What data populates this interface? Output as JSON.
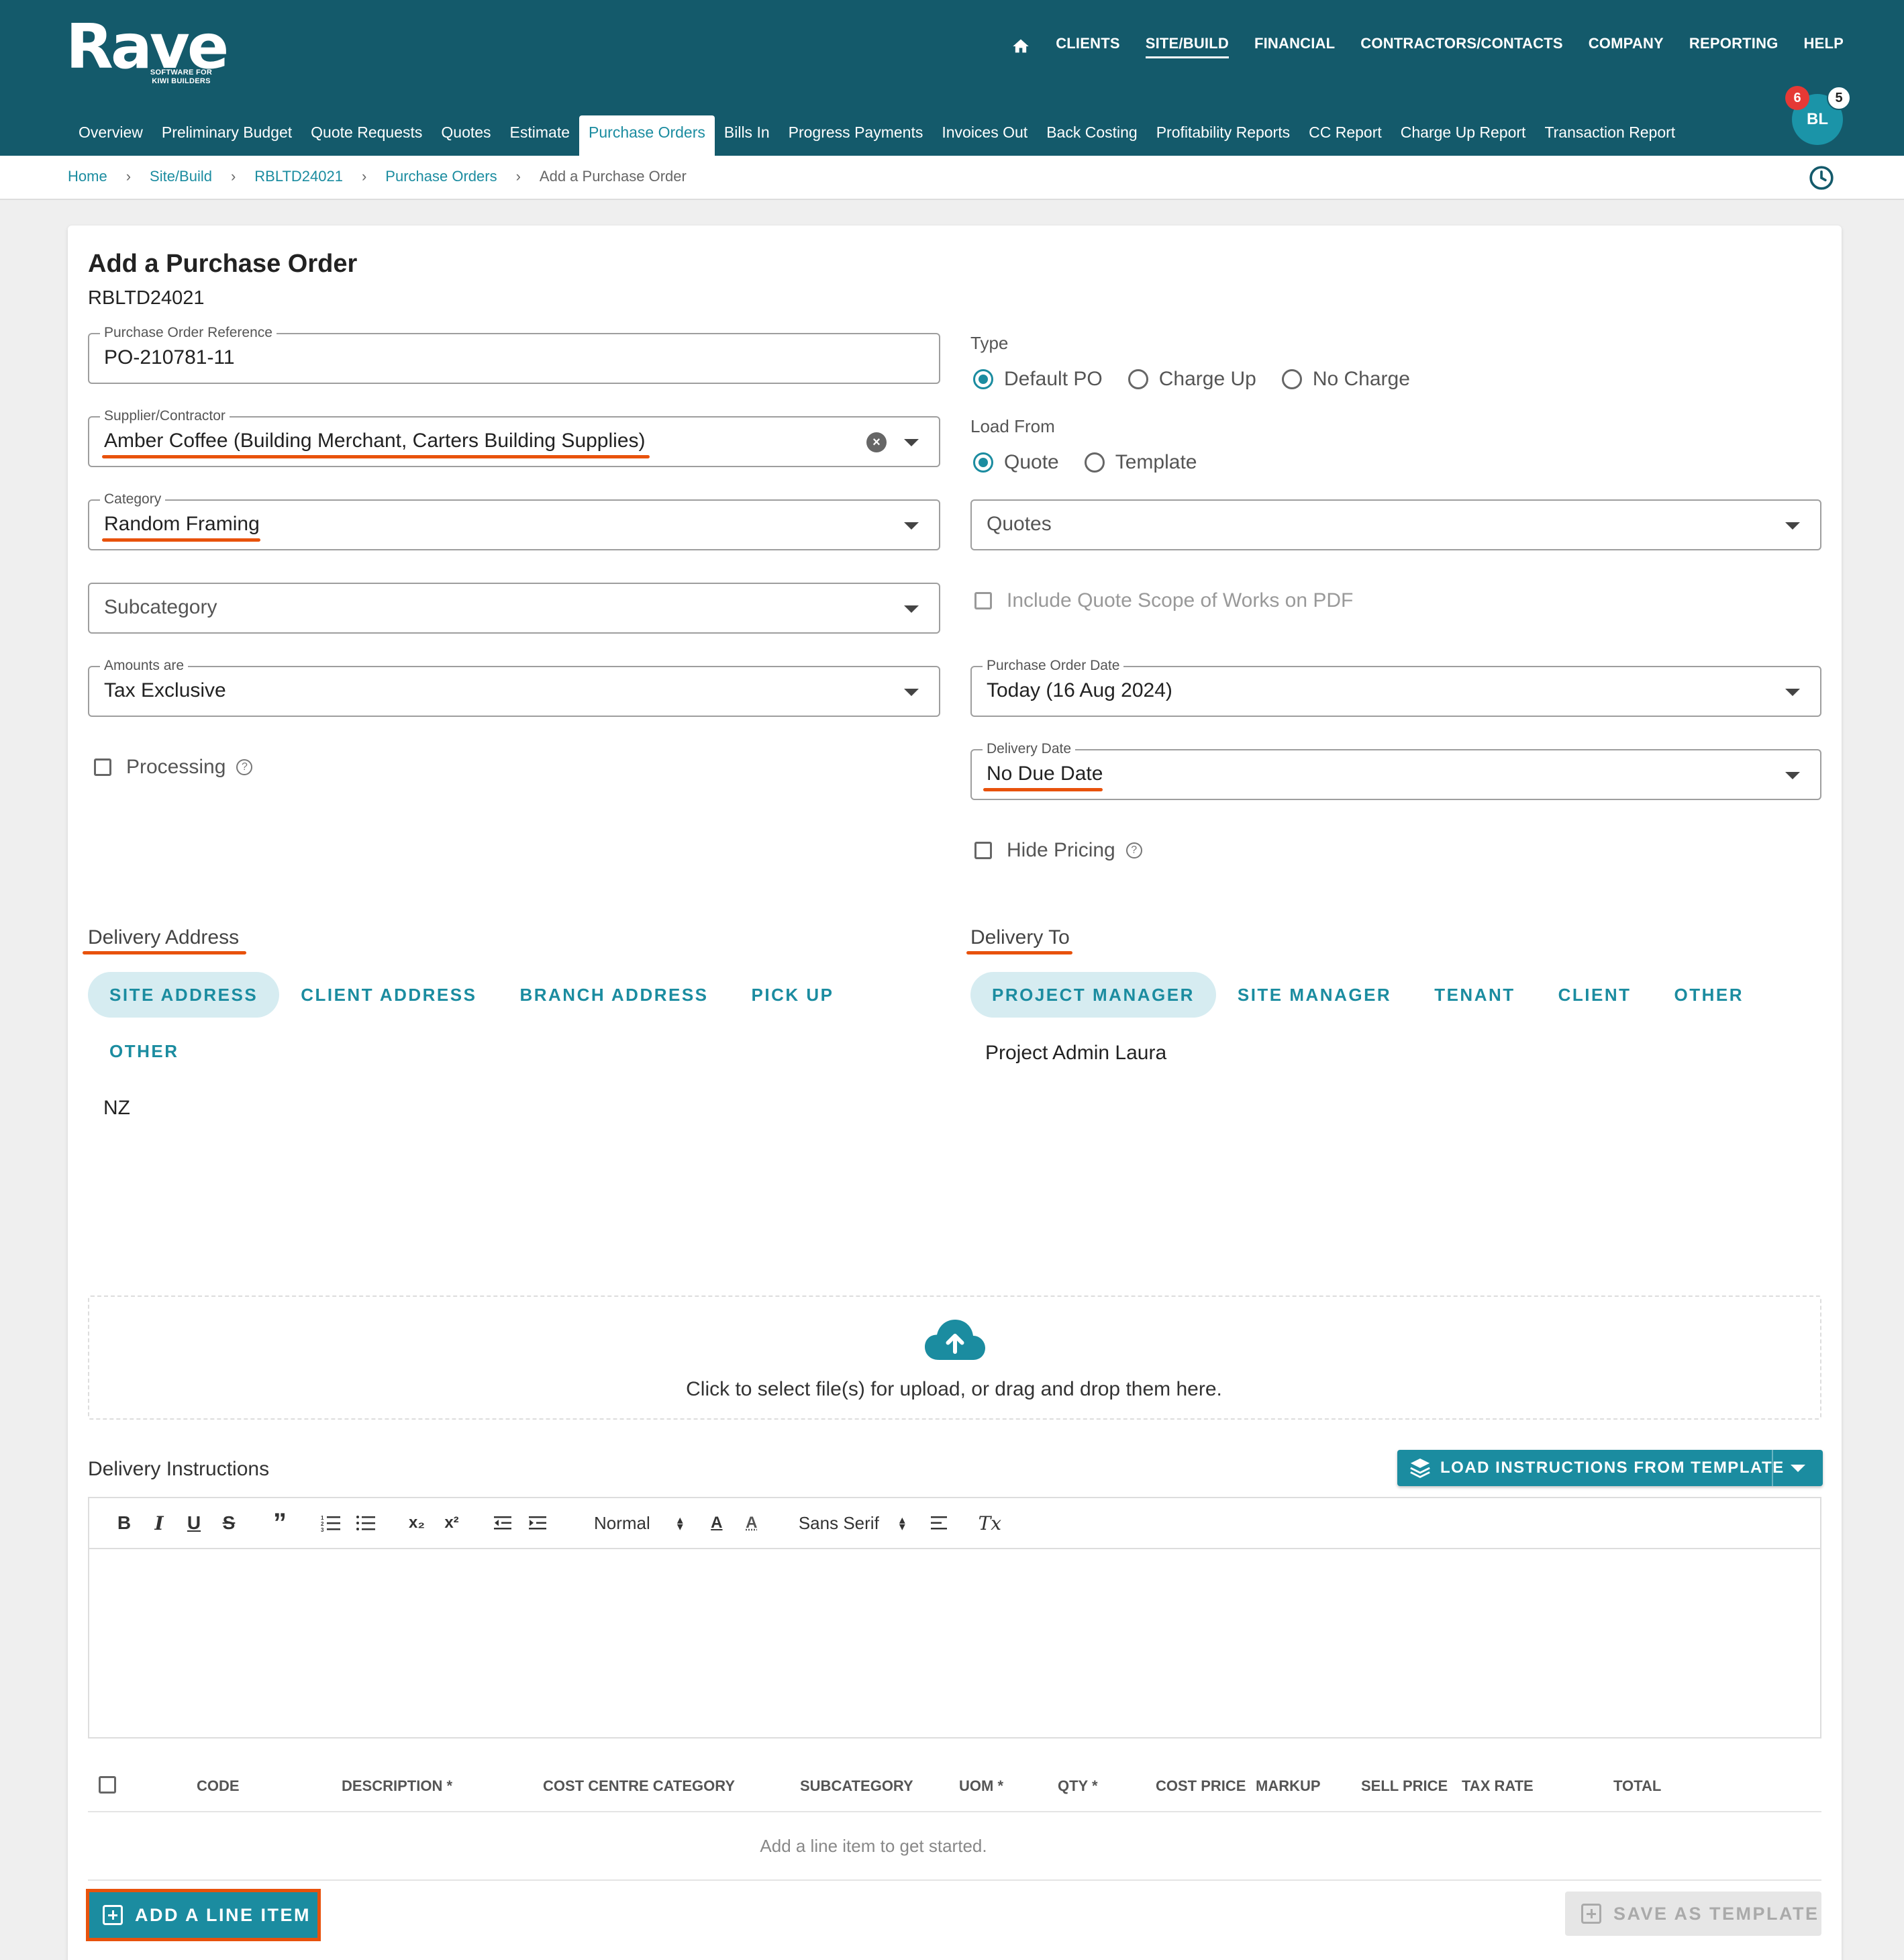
{
  "brand": {
    "name": "Rave",
    "tagline": "SOFTWARE FOR KIWI BUILDERS"
  },
  "top_nav": [
    "CLIENTS",
    "SITE/BUILD",
    "FINANCIAL",
    "CONTRACTORS/CONTACTS",
    "COMPANY",
    "REPORTING",
    "HELP"
  ],
  "top_nav_active": "SITE/BUILD",
  "sub_nav": [
    "Overview",
    "Preliminary Budget",
    "Quote Requests",
    "Quotes",
    "Estimate",
    "Purchase Orders",
    "Bills In",
    "Progress Payments",
    "Invoices Out",
    "Back Costing",
    "Profitability Reports",
    "CC Report",
    "Charge Up Report",
    "Transaction Report"
  ],
  "sub_nav_active": "Purchase Orders",
  "user": {
    "initials": "BL",
    "notifications": "6",
    "messages": "5"
  },
  "breadcrumb": [
    "Home",
    "Site/Build",
    "RBLTD24021",
    "Purchase Orders",
    "Add a Purchase Order"
  ],
  "page": {
    "title": "Add a Purchase Order",
    "job_code": "RBLTD24021"
  },
  "form": {
    "po_reference": {
      "label": "Purchase Order Reference",
      "value": "PO-210781-11"
    },
    "supplier": {
      "label": "Supplier/Contractor",
      "value": "Amber Coffee (Building Merchant, Carters Building Supplies)"
    },
    "category": {
      "label": "Category",
      "value": "Random Framing"
    },
    "subcategory": {
      "placeholder": "Subcategory"
    },
    "amounts": {
      "label": "Amounts are",
      "value": "Tax Exclusive"
    },
    "processing": {
      "label": "Processing",
      "checked": false
    },
    "type": {
      "label": "Type",
      "options": [
        "Default PO",
        "Charge Up",
        "No Charge"
      ],
      "selected": "Default PO"
    },
    "load_from": {
      "label": "Load From",
      "options": [
        "Quote",
        "Template"
      ],
      "selected": "Quote"
    },
    "quotes": {
      "placeholder": "Quotes"
    },
    "include_scope": {
      "label": "Include Quote Scope of Works on PDF",
      "checked": false
    },
    "po_date": {
      "label": "Purchase Order Date",
      "value": "Today (16 Aug 2024)"
    },
    "delivery_date": {
      "label": "Delivery Date",
      "value": "No Due Date"
    },
    "hide_pricing": {
      "label": "Hide Pricing",
      "checked": false
    }
  },
  "delivery_address": {
    "title": "Delivery Address",
    "options": [
      "SITE ADDRESS",
      "CLIENT ADDRESS",
      "BRANCH ADDRESS",
      "PICK UP",
      "OTHER"
    ],
    "selected": "SITE ADDRESS",
    "value": "NZ"
  },
  "delivery_to": {
    "title": "Delivery To",
    "options": [
      "PROJECT MANAGER",
      "SITE MANAGER",
      "TENANT",
      "CLIENT",
      "OTHER"
    ],
    "selected": "PROJECT MANAGER",
    "value": "Project Admin Laura"
  },
  "upload": {
    "text": "Click to select file(s) for upload, or drag and drop them here."
  },
  "instructions": {
    "title": "Delivery Instructions",
    "template_button": "LOAD INSTRUCTIONS FROM TEMPLATE",
    "toolbar": {
      "format": "Normal",
      "font": "Sans Serif",
      "bold": "B",
      "italic": "I",
      "underline": "U",
      "strike": "S",
      "quote": "”",
      "subscript": "x₂",
      "superscript": "x²",
      "clear": "Tx"
    }
  },
  "line_items": {
    "columns": [
      "CODE",
      "DESCRIPTION *",
      "COST CENTRE CATEGORY",
      "SUBCATEGORY",
      "UOM *",
      "QTY *",
      "COST PRICE",
      "MARKUP",
      "SELL PRICE",
      "TAX RATE",
      "TOTAL"
    ],
    "empty_message": "Add a line item to get started.",
    "add_button": "ADD A LINE ITEM",
    "save_template_button": "SAVE AS TEMPLATE"
  },
  "colors": {
    "header": "#145a6b",
    "accent": "#1b8ca0",
    "highlight": "#e8520c",
    "badge_red": "#e53935"
  }
}
